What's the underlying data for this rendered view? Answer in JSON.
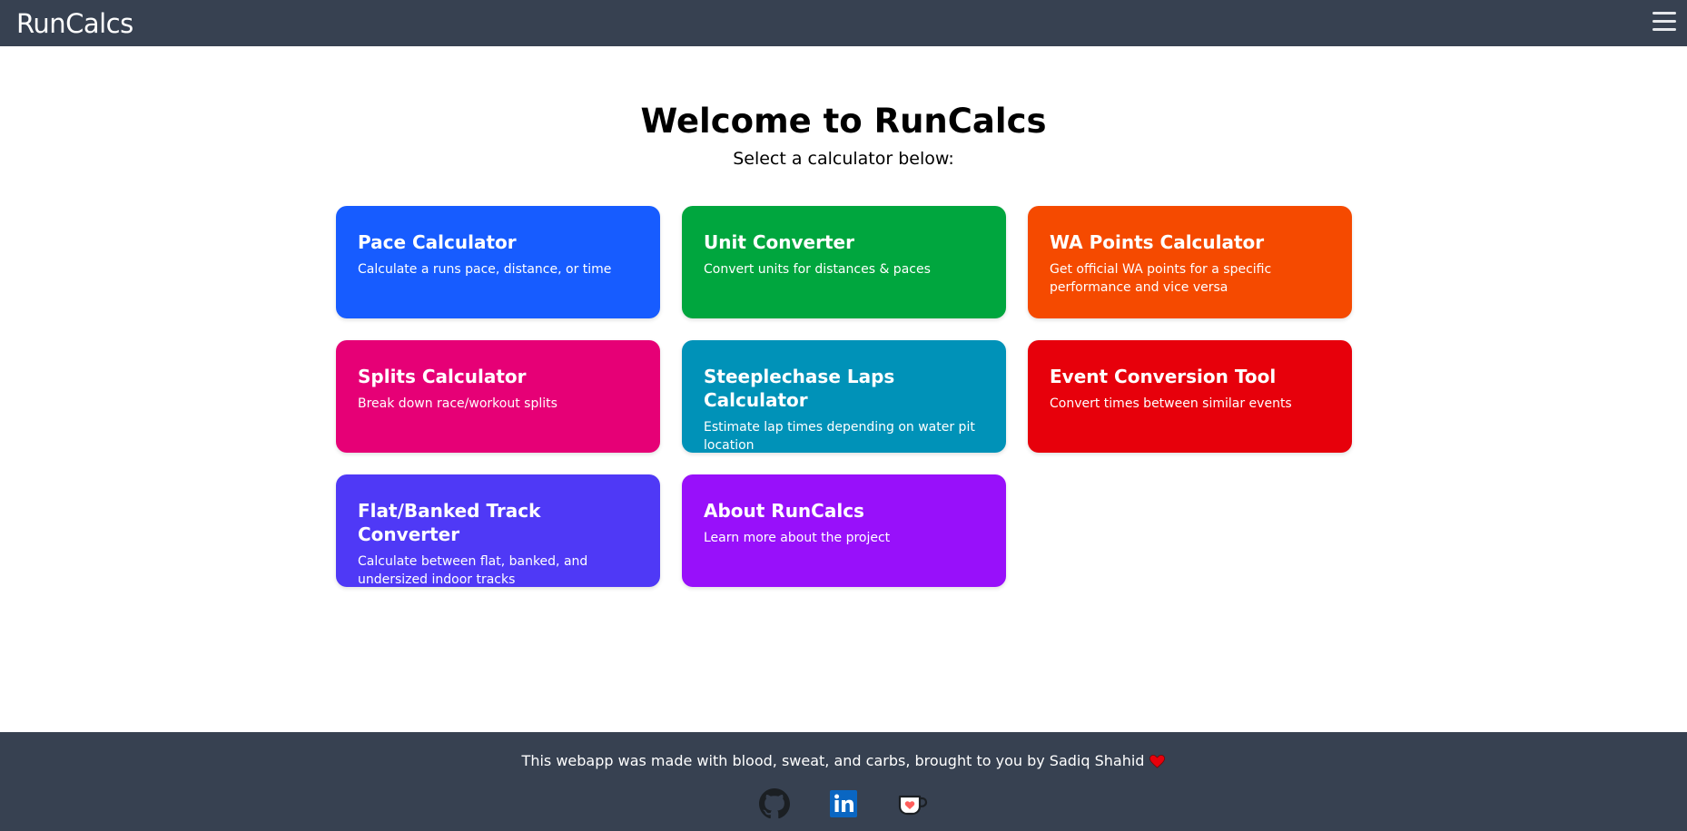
{
  "header": {
    "brand": "RunCalcs",
    "menu_icon": "hamburger-menu-icon"
  },
  "main": {
    "title": "Welcome to RunCalcs",
    "subtitle": "Select a calculator below:"
  },
  "cards": [
    {
      "title": "Pace Calculator",
      "description": "Calculate a runs pace, distance, or time",
      "color": "#175cff"
    },
    {
      "title": "Unit Converter",
      "description": "Convert units for distances & paces",
      "color": "#00a63e"
    },
    {
      "title": "WA Points Calculator",
      "description": "Get official WA points for a specific performance and vice versa",
      "color": "#f54a00"
    },
    {
      "title": "Splits Calculator",
      "description": "Break down race/workout splits",
      "color": "#e60076"
    },
    {
      "title": "Steeplechase Laps Calculator",
      "description": "Estimate lap times depending on water pit location",
      "color": "#0092b8"
    },
    {
      "title": "Event Conversion Tool",
      "description": "Convert times between similar events",
      "color": "#e7000b"
    },
    {
      "title": "Flat/Banked Track Converter",
      "description": "Calculate between flat, banked, and undersized indoor tracks",
      "color": "#4f39f6"
    },
    {
      "title": "About RunCalcs",
      "description": "Learn more about the project",
      "color": "#9810fa"
    }
  ],
  "footer": {
    "text": "This webapp was made with blood, sweat, and carbs, brought to you by Sadiq Shahid",
    "heart_icon": "heart-icon",
    "links": [
      {
        "icon": "github-icon"
      },
      {
        "icon": "linkedin-icon"
      },
      {
        "icon": "ko-fi-cup-icon"
      }
    ]
  },
  "colors": {
    "header_bg": "#374151",
    "footer_bg": "#374151",
    "heart": "#e7000b"
  }
}
